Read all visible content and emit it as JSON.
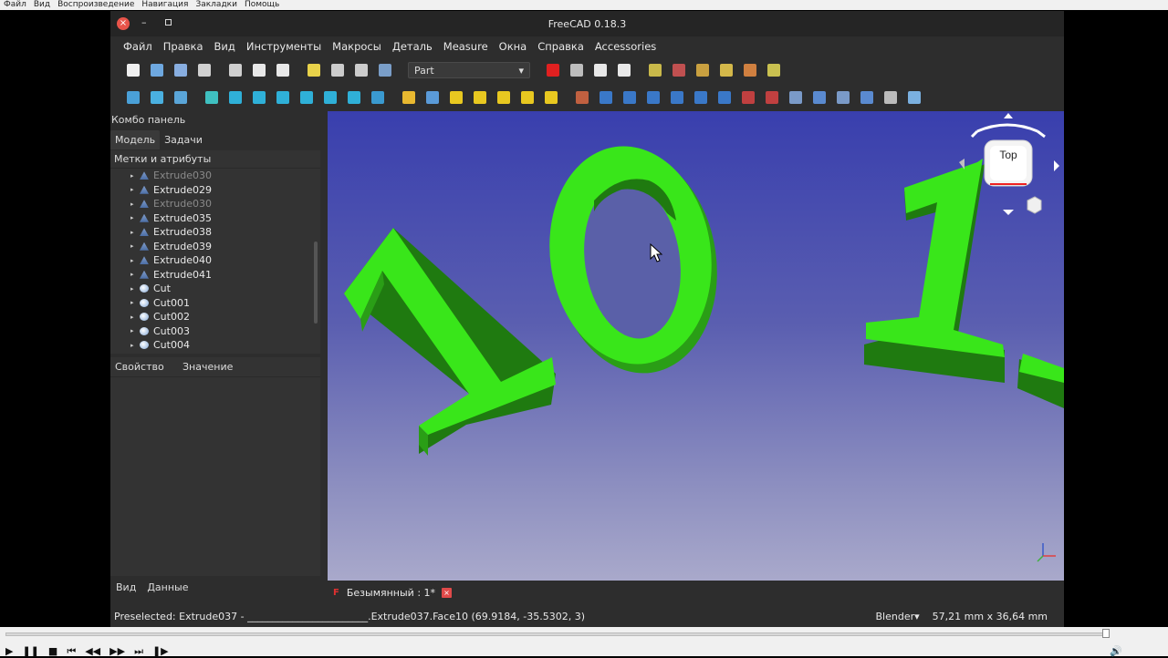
{
  "player": {
    "menu": [
      "Файл",
      "Вид",
      "Воспроизведение",
      "Навигация",
      "Закладки",
      "Помощь"
    ]
  },
  "window": {
    "title": "FreeCAD 0.18.3",
    "close_glyph": "×",
    "min_glyph": "–"
  },
  "menubar": [
    "Файл",
    "Правка",
    "Вид",
    "Инструменты",
    "Макросы",
    "Деталь",
    "Measure",
    "Окна",
    "Справка",
    "Accessories"
  ],
  "toolbar": {
    "workbench": "Part",
    "workbench_arrow": "▾",
    "row1_colors": [
      "#f0f0f0",
      "#6ea8e0",
      "#88aee0",
      "#d0d0d0",
      "#cfcfcf",
      "#e8e8e8",
      "#e8e8e8",
      "#e8d24a",
      "#cccccc",
      "#cccccc",
      "#7a9ec8",
      "#e02020",
      "#bdbdbd",
      "#e8e8e8",
      "#e8e8e8",
      "#c9b94a",
      "#c05050",
      "#c9a040",
      "#d4b84a",
      "#d08040",
      "#c9c050"
    ],
    "row2_colors": [
      "#4aa0d8",
      "#4ab0e0",
      "#5aa5d8",
      "#3fc0c0",
      "#2fb0d8",
      "#2fb0d8",
      "#2fb0d8",
      "#2fb0d8",
      "#2fb0d8",
      "#2fb0d8",
      "#3a9ad0",
      "#e8b830",
      "#5a9ad8",
      "#e8c820",
      "#e8c820",
      "#e8c820",
      "#e8c820",
      "#e8c820",
      "#c06040",
      "#3a78c8",
      "#3a78c8",
      "#3a78c8",
      "#3a78c8",
      "#3a78c8",
      "#3a78c8",
      "#c04040",
      "#c04040",
      "#7a9ac8",
      "#5a8ad0",
      "#7a9ac8",
      "#5a8ad0",
      "#bbbbbb",
      "#7ab0e0"
    ]
  },
  "combo": {
    "title": "Комбо панель",
    "tabs": [
      "Модель",
      "Задачи"
    ],
    "tree_header": "Метки и атрибуты",
    "arrow": "▸",
    "items": [
      {
        "label": "Extrude030",
        "kind": "extrude",
        "dim": true
      },
      {
        "label": "Extrude029",
        "kind": "extrude",
        "dim": false
      },
      {
        "label": "Extrude030",
        "kind": "extrude",
        "dim": true
      },
      {
        "label": "Extrude035",
        "kind": "extrude",
        "dim": false
      },
      {
        "label": "Extrude038",
        "kind": "extrude",
        "dim": false
      },
      {
        "label": "Extrude039",
        "kind": "extrude",
        "dim": false
      },
      {
        "label": "Extrude040",
        "kind": "extrude",
        "dim": false
      },
      {
        "label": "Extrude041",
        "kind": "extrude",
        "dim": false
      },
      {
        "label": "Cut",
        "kind": "cut",
        "dim": false
      },
      {
        "label": "Cut001",
        "kind": "cut",
        "dim": false
      },
      {
        "label": "Cut002",
        "kind": "cut",
        "dim": false
      },
      {
        "label": "Cut003",
        "kind": "cut",
        "dim": false
      },
      {
        "label": "Cut004",
        "kind": "cut",
        "dim": false
      }
    ],
    "prop_columns": [
      "Свойство",
      "Значение"
    ],
    "bottom_tabs": [
      "Вид",
      "Данные"
    ]
  },
  "viewport": {
    "navcube_label": "Top"
  },
  "document_tab": {
    "logo": "F",
    "label": "Безымянный : 1*",
    "close": "×"
  },
  "status": {
    "preselected": "Preselected: Extrude037 - ________________________.Extrude037.Face10 (69.9184, -35.5302, 3)",
    "nav_style": "Blender▾",
    "dimensions": "57,21 mm x 36,64 mm"
  },
  "player_controls": [
    "▶",
    "❚❚",
    "■",
    "⏮",
    "◀◀",
    "▶▶",
    "⏭",
    "❚▶"
  ],
  "volume": "🔊"
}
